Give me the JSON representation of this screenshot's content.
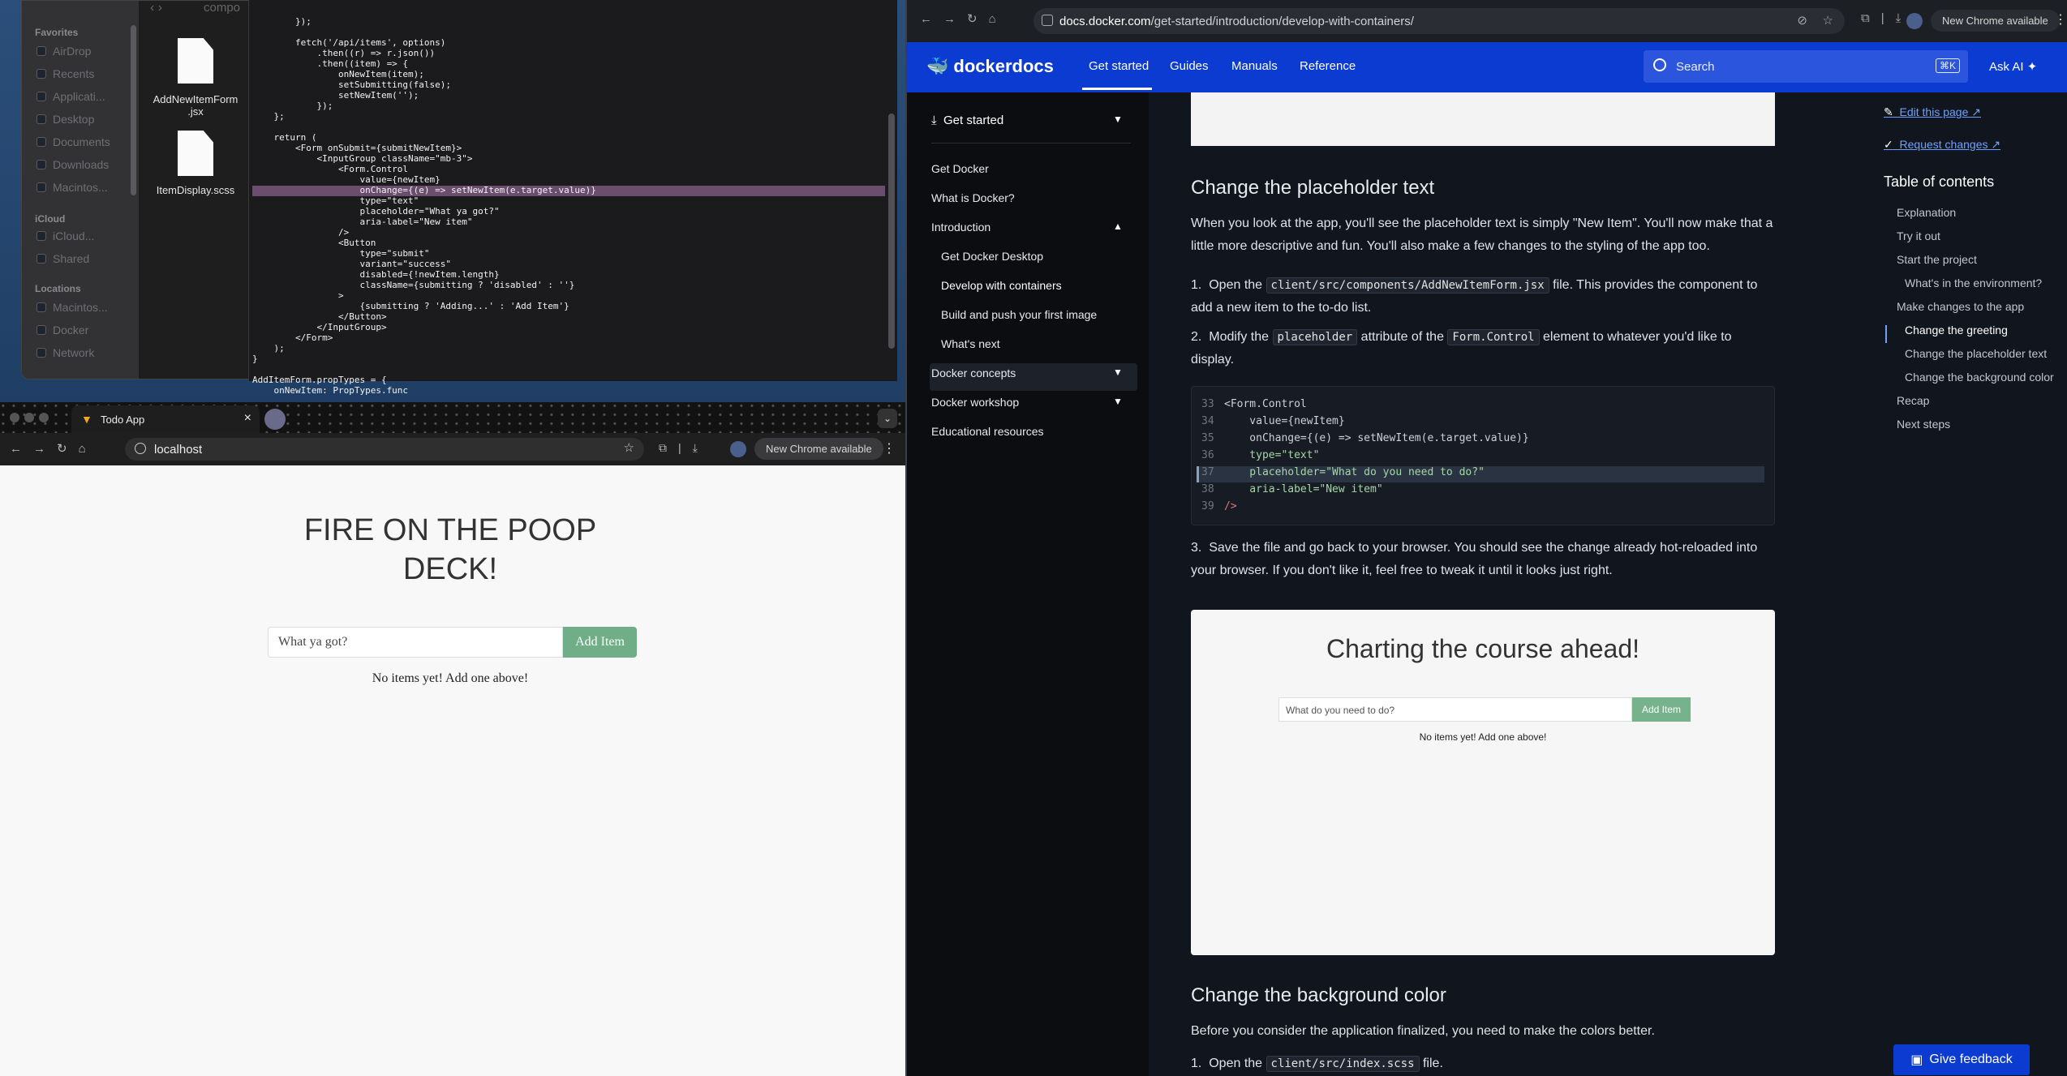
{
  "finder": {
    "favorites_heading": "Favorites",
    "favorites": [
      "AirDrop",
      "Recents",
      "Applicati...",
      "Desktop",
      "Documents",
      "Downloads",
      "Macintos..."
    ],
    "icloud_heading": "iCloud",
    "icloud": [
      "iCloud...",
      "Shared"
    ],
    "locations_heading": "Locations",
    "locations": [
      "Macintos...",
      "Docker",
      "Network"
    ],
    "path_label": "compo",
    "files": [
      "AddNewItemForm\n.jsx",
      "ItemDisplay.scss"
    ]
  },
  "editor": {
    "code": "        });\n\n        fetch('/api/items', options)\n            .then((r) => r.json())\n            .then((item) => {\n                onNewItem(item);\n                setSubmitting(false);\n                setNewItem('');\n            });\n    };\n\n    return (\n        <Form onSubmit={submitNewItem}>\n            <InputGroup className=\"mb-3\">\n                <Form.Control\n                    value={newItem}\n                    onChange={(e) => setNewItem(e.target.value)}\n                    type=\"text\"\n                    placeholder=\"What ya got?\"\n                    aria-label=\"New item\"\n                />\n                <Button\n                    type=\"submit\"\n                    variant=\"success\"\n                    disabled={!newItem.length}\n                    className={submitting ? 'disabled' : ''}\n                >\n                    {submitting ? 'Adding...' : 'Add Item'}\n                </Button>\n            </InputGroup>\n        </Form>\n    );\n}\n\nAddItemForm.propTypes = {\n    onNewItem: PropTypes.func"
  },
  "todo_browser": {
    "tab_title": "Todo App",
    "url": "localhost",
    "update_chip": "New Chrome available",
    "heading": "FIRE ON THE POOP DECK!",
    "input_placeholder": "What ya got?",
    "add_button": "Add Item",
    "empty_text": "No items yet! Add one above!"
  },
  "docs_browser": {
    "url_domain": "docs.docker.com",
    "url_path": "/get-started/introduction/develop-with-containers/",
    "update_chip": "New Chrome available",
    "brand": "dockerdocs",
    "nav": [
      "Get started",
      "Guides",
      "Manuals",
      "Reference"
    ],
    "search_placeholder": "Search",
    "search_shortcut": "⌘K",
    "ask_ai": "Ask AI",
    "sidebar": {
      "section": "Get started",
      "items": [
        {
          "label": "Get Docker",
          "sub": false
        },
        {
          "label": "What is Docker?",
          "sub": false
        },
        {
          "label": "Introduction",
          "sub": false
        },
        {
          "label": "Get Docker Desktop",
          "sub": true
        },
        {
          "label": "Develop with containers",
          "sub": true
        },
        {
          "label": "Build and push your first image",
          "sub": true
        },
        {
          "label": "What's next",
          "sub": true
        },
        {
          "label": "Docker concepts",
          "sub": false
        },
        {
          "label": "Docker workshop",
          "sub": false
        },
        {
          "label": "Educational resources",
          "sub": false
        }
      ]
    },
    "article": {
      "h_placeholder": "Change the placeholder text",
      "p1": "When you look at the app, you'll see the placeholder text is simply \"New Item\". You'll now make that a little more descriptive and fun. You'll also make a few changes to the styling of the app too.",
      "step1_pre": "Open the",
      "step1_code": "client/src/components/AddNewItemForm.jsx",
      "step1_post": "file. This provides the component to add a new item to the to-do list.",
      "step2_pre": "Modify the",
      "step2_code1": "placeholder",
      "step2_mid": "attribute of the",
      "step2_code2": "Form.Control",
      "step2_post": "element to whatever you'd like to display.",
      "code_lines": [
        {
          "n": "33",
          "t": "<Form.Control"
        },
        {
          "n": "34",
          "t": "    value={newItem}"
        },
        {
          "n": "35",
          "t": "    onChange={(e) => setNewItem(e.target.value)}"
        },
        {
          "n": "36",
          "t": "    type=\"text\""
        },
        {
          "n": "37",
          "t": "    placeholder=\"What do you need to do?\""
        },
        {
          "n": "38",
          "t": "    aria-label=\"New item\""
        },
        {
          "n": "39",
          "t": "/>"
        }
      ],
      "step3": "Save the file and go back to your browser. You should see the change already hot-reloaded into your browser. If you don't like it, feel free to tweak it until it looks just right.",
      "shot_heading": "Charting the course ahead!",
      "shot_placeholder": "What do you need to do?",
      "shot_button": "Add Item",
      "shot_empty": "No items yet! Add one above!",
      "h_background": "Change the background color",
      "p2": "Before you consider the application finalized, you need to make the colors better.",
      "step4_pre": "Open the",
      "step4_code": "client/src/index.scss",
      "step4_post": "file."
    },
    "toc": {
      "edit": "Edit this page",
      "request": "Request changes",
      "title": "Table of contents",
      "items": [
        {
          "label": "Explanation",
          "sub": false
        },
        {
          "label": "Try it out",
          "sub": false
        },
        {
          "label": "Start the project",
          "sub": false
        },
        {
          "label": "What's in the environment?",
          "sub": true
        },
        {
          "label": "Make changes to the app",
          "sub": false
        },
        {
          "label": "Change the greeting",
          "sub": true
        },
        {
          "label": "Change the placeholder text",
          "sub": true
        },
        {
          "label": "Change the background color",
          "sub": true
        },
        {
          "label": "Recap",
          "sub": false
        },
        {
          "label": "Next steps",
          "sub": false
        }
      ]
    },
    "feedback": "Give feedback"
  }
}
